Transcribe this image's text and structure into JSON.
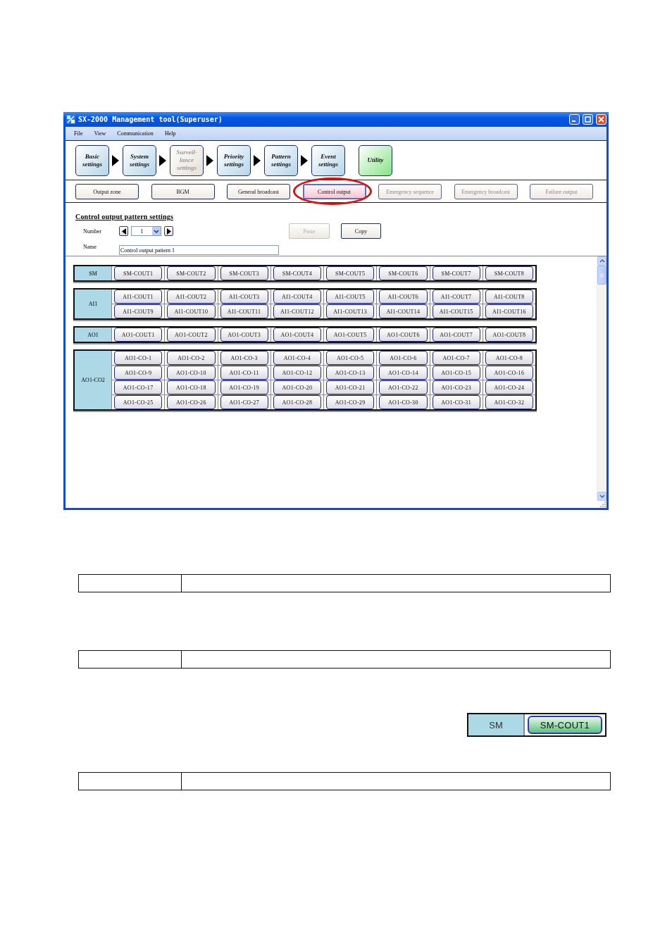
{
  "window": {
    "title": "SX-2000 Management tool(Superuser)"
  },
  "menu": [
    "File",
    "View",
    "Communication",
    "Help"
  ],
  "workflow_steps": [
    {
      "label": "Basic\nsettings",
      "kind": "step",
      "disabled": false
    },
    {
      "label": "System\nsettings",
      "kind": "step",
      "disabled": false
    },
    {
      "label": "Surveil-\nlance\nsettings",
      "kind": "step",
      "disabled": true
    },
    {
      "label": "Priority\nsettings",
      "kind": "step",
      "disabled": false
    },
    {
      "label": "Pattern\nsettings",
      "kind": "step",
      "disabled": false
    },
    {
      "label": "Event\nsettings",
      "kind": "step",
      "disabled": false
    },
    {
      "label": "Utility",
      "kind": "utility",
      "disabled": false
    }
  ],
  "subtabs": [
    {
      "label": "Output zone",
      "selected": false,
      "disabled": false,
      "circled": false
    },
    {
      "label": "BGM",
      "selected": false,
      "disabled": false,
      "circled": false
    },
    {
      "label": "General broadcast",
      "selected": false,
      "disabled": false,
      "circled": false
    },
    {
      "label": "Control output",
      "selected": true,
      "disabled": false,
      "circled": true
    },
    {
      "label": "Emergency sequence",
      "selected": false,
      "disabled": true,
      "circled": false
    },
    {
      "label": "Emergency broadcast",
      "selected": false,
      "disabled": true,
      "circled": false
    },
    {
      "label": "Failure output",
      "selected": false,
      "disabled": true,
      "circled": false
    }
  ],
  "section_title": "Control output pattern settings",
  "number": {
    "label": "Number",
    "value": "1"
  },
  "name": {
    "label": "Name",
    "value": "Control output pattern 1"
  },
  "buttons": [
    {
      "label": "Paste",
      "disabled": true
    },
    {
      "label": "Copy",
      "disabled": false
    }
  ],
  "groups": [
    {
      "label": "SM",
      "outputs": [
        {
          "label": "SM-COUT1",
          "selected": false
        },
        {
          "label": "SM-COUT2",
          "selected": false
        },
        {
          "label": "SM-COUT3",
          "selected": false
        },
        {
          "label": "SM-COUT4",
          "selected": false
        },
        {
          "label": "SM-COUT5",
          "selected": false
        },
        {
          "label": "SM-COUT6",
          "selected": false
        },
        {
          "label": "SM-COUT7",
          "selected": false
        },
        {
          "label": "SM-COUT8",
          "selected": false
        }
      ]
    },
    {
      "label": "AI1",
      "outputs": [
        {
          "label": "AI1-COUT1",
          "selected": false
        },
        {
          "label": "AI1-COUT2",
          "selected": false
        },
        {
          "label": "AI1-COUT3",
          "selected": false
        },
        {
          "label": "AI1-COUT4",
          "selected": false
        },
        {
          "label": "AI1-COUT5",
          "selected": false
        },
        {
          "label": "AI1-COUT6",
          "selected": false
        },
        {
          "label": "AI1-COUT7",
          "selected": false
        },
        {
          "label": "AI1-COUT8",
          "selected": false
        },
        {
          "label": "AI1-COUT9",
          "selected": false
        },
        {
          "label": "AI1-COUT10",
          "selected": false
        },
        {
          "label": "AI1-COUT11",
          "selected": false
        },
        {
          "label": "AI1-COUT12",
          "selected": false
        },
        {
          "label": "AI1-COUT13",
          "selected": false
        },
        {
          "label": "AI1-COUT14",
          "selected": false
        },
        {
          "label": "AI1-COUT15",
          "selected": false
        },
        {
          "label": "AI1-COUT16",
          "selected": false
        }
      ]
    },
    {
      "label": "AO1",
      "outputs": [
        {
          "label": "AO1-COUT1",
          "selected": false
        },
        {
          "label": "AO1-COUT2",
          "selected": false
        },
        {
          "label": "AO1-COUT3",
          "selected": false
        },
        {
          "label": "AO1-COUT4",
          "selected": false
        },
        {
          "label": "AO1-COUT5",
          "selected": false
        },
        {
          "label": "AO1-COUT6",
          "selected": false
        },
        {
          "label": "AO1-COUT7",
          "selected": false
        },
        {
          "label": "AO1-COUT8",
          "selected": false
        }
      ]
    },
    {
      "label": "AO1-CO2",
      "outputs": [
        {
          "label": "AO1-CO-1",
          "selected": false
        },
        {
          "label": "AO1-CO-2",
          "selected": false
        },
        {
          "label": "AO1-CO-3",
          "selected": false
        },
        {
          "label": "AO1-CO-4",
          "selected": false
        },
        {
          "label": "AO1-CO-5",
          "selected": false
        },
        {
          "label": "AO1-CO-6",
          "selected": false
        },
        {
          "label": "AO1-CO-7",
          "selected": false
        },
        {
          "label": "AO1-CO-8",
          "selected": false
        },
        {
          "label": "AO1-CO-9",
          "selected": false
        },
        {
          "label": "AO1-CO-10",
          "selected": false
        },
        {
          "label": "AO1-CO-11",
          "selected": false
        },
        {
          "label": "AO1-CO-12",
          "selected": false
        },
        {
          "label": "AO1-CO-13",
          "selected": false
        },
        {
          "label": "AO1-CO-14",
          "selected": false
        },
        {
          "label": "AO1-CO-15",
          "selected": false
        },
        {
          "label": "AO1-CO-16",
          "selected": false
        },
        {
          "label": "AO1-CO-17",
          "selected": false
        },
        {
          "label": "AO1-CO-18",
          "selected": false
        },
        {
          "label": "AO1-CO-19",
          "selected": false
        },
        {
          "label": "AO1-CO-20",
          "selected": false
        },
        {
          "label": "AO1-CO-21",
          "selected": false
        },
        {
          "label": "AO1-CO-22",
          "selected": false
        },
        {
          "label": "AO1-CO-23",
          "selected": false
        },
        {
          "label": "AO1-CO-24",
          "selected": false
        },
        {
          "label": "AO1-CO-25",
          "selected": false
        },
        {
          "label": "AO1-CO-26",
          "selected": false
        },
        {
          "label": "AO1-CO-27",
          "selected": false
        },
        {
          "label": "AO1-CO-28",
          "selected": false
        },
        {
          "label": "AO1-CO-29",
          "selected": false
        },
        {
          "label": "AO1-CO-30",
          "selected": false
        },
        {
          "label": "AO1-CO-31",
          "selected": false
        },
        {
          "label": "AO1-CO-32",
          "selected": false
        }
      ]
    }
  ],
  "example": {
    "group_label": "SM",
    "output": {
      "label": "SM-COUT1",
      "selected": true
    }
  }
}
